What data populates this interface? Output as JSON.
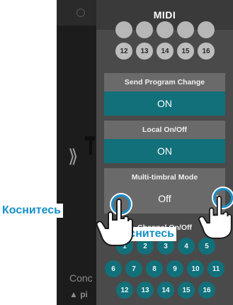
{
  "panel": {
    "title": "MIDI",
    "channel_rows_top": [
      "12",
      "13",
      "14",
      "15",
      "16"
    ],
    "send_program_change": {
      "label": "Send Program Change",
      "value": "ON"
    },
    "local_on_off": {
      "label": "Local On/Off",
      "value": "ON"
    },
    "multi_timbral": {
      "label": "Multi-timbral Mode",
      "value": "Off"
    },
    "channel_on_off": {
      "label": "Channel On/Off",
      "row1": [
        "1",
        "2",
        "3",
        "4",
        "5"
      ],
      "row2": [
        "6",
        "7",
        "8",
        "9",
        "10",
        "11"
      ],
      "row3": [
        "12",
        "13",
        "14",
        "15",
        "16"
      ]
    }
  },
  "background": {
    "text1": "Conc",
    "text2": "pi"
  },
  "overlay": {
    "touch_label": "Коснитесь"
  },
  "colors": {
    "accent": "#11707a",
    "touch": "#1590c8",
    "panel": "#4a4a4a"
  }
}
